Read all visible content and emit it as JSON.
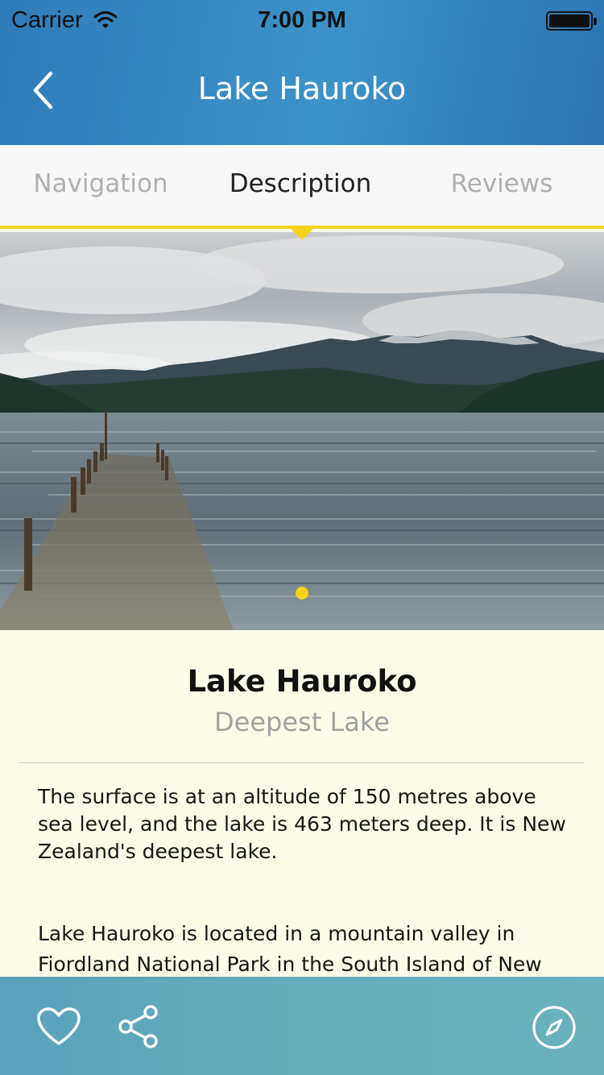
{
  "status_bar": {
    "carrier": "Carrier",
    "time": "7:00 PM"
  },
  "header": {
    "title": "Lake Hauroko",
    "back_icon": "chevron-left-icon"
  },
  "tabs": [
    {
      "label": "Navigation",
      "active": false
    },
    {
      "label": "Description",
      "active": true
    },
    {
      "label": "Reviews",
      "active": false
    }
  ],
  "gallery": {
    "pages": 1,
    "current_page": 1
  },
  "detail": {
    "name": "Lake Hauroko",
    "subtitle": "Deepest Lake",
    "paragraphs": [
      "The surface is at an altitude of 150 metres above sea level, and the lake is 463 meters deep. It is New Zealand's deepest lake.",
      "Lake Hauroko is located in a mountain valley in Fiordland National Park in the South Island of New"
    ]
  },
  "bottom_bar": {
    "icons": [
      "heart-icon",
      "share-icon",
      "compass-icon"
    ]
  },
  "colors": {
    "accent": "#f3d21b",
    "header_blue": "#3d93c9",
    "content_bg": "#fdfce9",
    "bottom_bar": "#64aebd"
  }
}
